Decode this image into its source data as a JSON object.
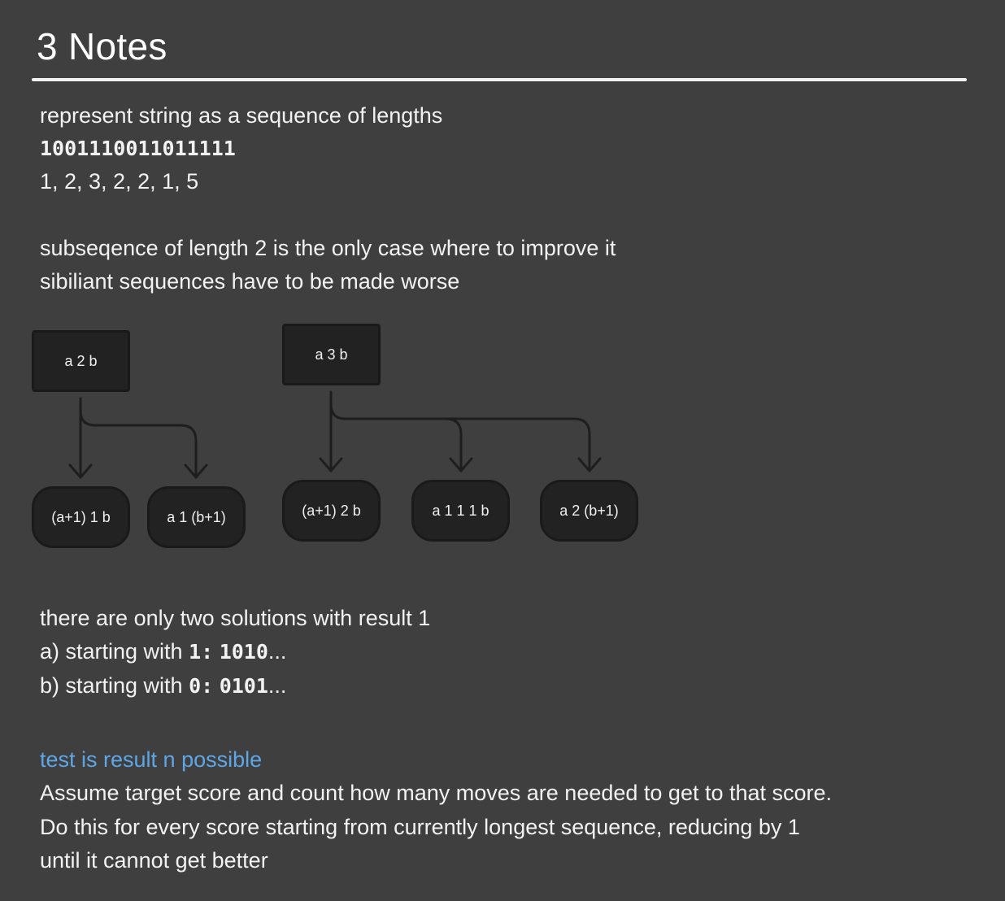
{
  "page": {
    "title": "3 Notes"
  },
  "section1": {
    "line1": "represent string as a sequence of lengths",
    "line2": "10011100110 11111",
    "line2_exact": "1001110011011111",
    "line3": "1, 2, 3, 2, 2, 1, 5"
  },
  "section2": {
    "line1": "subseqence of length 2 is the only case where to improve it",
    "line2": "sibiliant sequences have to be made worse"
  },
  "diagram": {
    "left": {
      "root": "a 2 b",
      "children": [
        "(a+1) 1 b",
        "a 1 (b+1)"
      ]
    },
    "right": {
      "root": "a 3 b",
      "children": [
        "(a+1) 2 b",
        "a 1 1 1 b",
        "a 2 (b+1)"
      ]
    },
    "colors": {
      "node_fill": "#222222",
      "arrow": "#1e1e1e"
    }
  },
  "section3": {
    "line1": "there are only two solutions with result 1",
    "a_prefix": "a) starting with ",
    "a_code": "1:",
    "a_code2": "1010",
    "a_suffix": "...",
    "b_prefix": "b) starting with ",
    "b_code": "0:",
    "b_code2": "0101",
    "b_suffix": "..."
  },
  "section4": {
    "link": "test is result n possible",
    "line1": "Assume target score and count how many moves are needed to get to that score.",
    "line2": "Do this for every score starting from currently longest sequence, reducing by 1",
    "line3": "until it cannot get better",
    "link_color": "#5ea6e6"
  }
}
